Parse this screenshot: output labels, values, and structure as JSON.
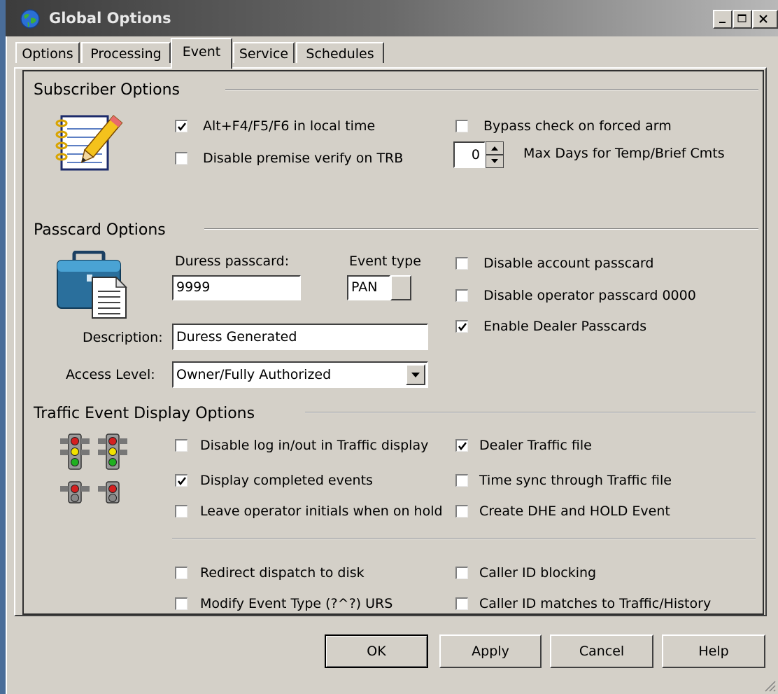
{
  "window": {
    "title": "Global Options"
  },
  "tabs": [
    {
      "label": "Options"
    },
    {
      "label": "Processing"
    },
    {
      "label": "Event",
      "active": true
    },
    {
      "label": "Service"
    },
    {
      "label": "Schedules"
    }
  ],
  "subscriber": {
    "title": "Subscriber Options",
    "alt_f4": {
      "label": "Alt+F4/F5/F6 in local time",
      "checked": true
    },
    "disable_premise": {
      "label": "Disable premise verify on TRB",
      "checked": false
    },
    "bypass_check": {
      "label": "Bypass check on forced arm",
      "checked": false
    },
    "max_days": {
      "value": "0",
      "label": "Max Days for Temp/Brief Cmts"
    }
  },
  "passcard": {
    "title": "Passcard Options",
    "duress_label": "Duress passcard:",
    "duress_value": "9999",
    "event_type_label": "Event type",
    "event_type_value": "PAN",
    "description_label": "Description:",
    "description_value": "Duress Generated",
    "access_label": "Access Level:",
    "access_value": "Owner/Fully Authorized",
    "disable_account": {
      "label": "Disable account passcard",
      "checked": false
    },
    "disable_operator": {
      "label": "Disable operator passcard 0000",
      "checked": false
    },
    "enable_dealer": {
      "label": "Enable Dealer Passcards",
      "checked": true
    }
  },
  "traffic": {
    "title": "Traffic Event Display Options",
    "disable_log": {
      "label": "Disable log in/out in Traffic display",
      "checked": false
    },
    "display_completed": {
      "label": "Display completed events",
      "checked": true
    },
    "leave_initials": {
      "label": "Leave operator initials when on hold",
      "checked": false
    },
    "dealer_traffic": {
      "label": "Dealer Traffic file",
      "checked": true
    },
    "time_sync": {
      "label": "Time sync through Traffic file",
      "checked": false
    },
    "create_dhe": {
      "label": "Create DHE and HOLD Event",
      "checked": false
    },
    "redirect_dispatch": {
      "label": "Redirect dispatch to disk",
      "checked": false
    },
    "modify_event": {
      "label": "Modify Event Type (?^?) URS",
      "checked": false
    },
    "caller_blocking": {
      "label": "Caller ID blocking",
      "checked": false
    },
    "caller_matches": {
      "label": "Caller ID matches to Traffic/History",
      "checked": false
    }
  },
  "buttons": {
    "ok": "OK",
    "apply": "Apply",
    "cancel": "Cancel",
    "help": "Help"
  },
  "icons": {
    "app": "globe-icon",
    "subscriber": "notepad-pencil-icon",
    "passcard": "briefcase-document-icon",
    "traffic": "traffic-lights-icon"
  }
}
